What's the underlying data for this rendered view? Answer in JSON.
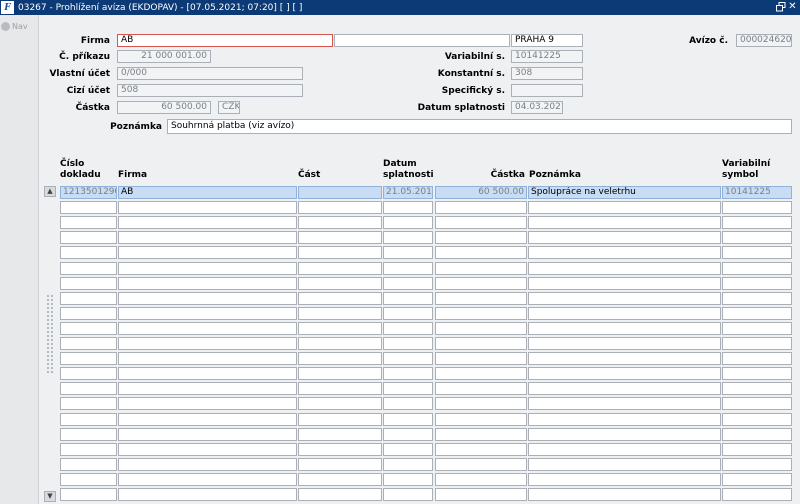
{
  "window": {
    "title": "03267 - Prohlížení avíza (EKDOPAV) - [07.05.2021; 07:20]  [ ]  [ ]",
    "icon_text": "F",
    "restore_icon": "restore-icon",
    "close_icon": "close-icon"
  },
  "nav": {
    "label": "Nav"
  },
  "form": {
    "firma_label": "Firma",
    "firma_value": "AB",
    "firma_name": "",
    "firma_city": "PRAHA 9",
    "avizo_label": "Avízo č.",
    "avizo_value": "0000246208",
    "prikaz_label": "Č. příkazu",
    "prikaz_value": "21 000 001.00",
    "variabilni_label": "Variabilní s.",
    "variabilni_value": "10141225",
    "vlastni_label": "Vlastní účet",
    "vlastni_value": "0/000",
    "konstantni_label": "Konstantní s.",
    "konstantni_value": "308",
    "cizi_label": "Cizí účet",
    "cizi_value": "508",
    "specificky_label": "Specifický s.",
    "specificky_value": "",
    "castka_label": "Částka",
    "castka_value": "60 500.00",
    "mena_value": "CZK",
    "datum_label": "Datum splatnosti",
    "datum_value": "04.03.2021",
    "poznamka_label": "Poznámka",
    "poznamka_value": "Souhrnná platba (viz avízo)"
  },
  "table": {
    "headers": {
      "cislo_l1": "Číslo",
      "cislo_l2": "dokladu",
      "firma": "Firma",
      "cast": "Část",
      "datum_l1": "Datum",
      "datum_l2": "splatnosti",
      "castka": "Částka",
      "poznamka": "Poznámka",
      "vs_l1": "Variabilní",
      "vs_l2": "symbol"
    },
    "rows": [
      {
        "cislo": "1213501290",
        "firma": "AB",
        "cast": "",
        "datum": "21.05.2013",
        "castka": "60 500.00",
        "poznamka": "Spolupráce na veletrhu",
        "vs": "10141225"
      }
    ]
  }
}
